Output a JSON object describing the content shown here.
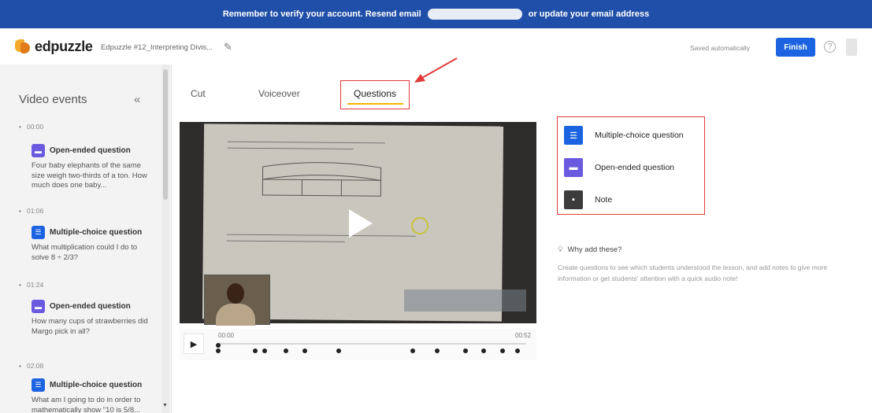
{
  "banner": {
    "text_before": "Remember to verify your account. Resend email",
    "text_after": "or update your email address"
  },
  "header": {
    "logo": "edpuzzle",
    "doc_title": "Edpuzzle #12_Interpreting Divis...",
    "saved": "Saved automatically",
    "finish": "Finish",
    "help": "?"
  },
  "sidebar": {
    "title": "Video events",
    "collapse": "«",
    "events": [
      {
        "time": "00:00",
        "type": "Open-ended question",
        "text": "Four baby elephants of the same size weigh two-thirds of a ton. How much does one baby..."
      },
      {
        "time": "01:06",
        "type": "Multiple-choice question",
        "text": "What multiplication could I do to solve 8 ÷ 2/3?"
      },
      {
        "time": "01:24",
        "type": "Open-ended question",
        "text": "How many cups of strawberries did Margo pick in all?"
      },
      {
        "time": "02:08",
        "type": "Multiple-choice question",
        "text": "What am I going to do in order to mathematically show \"10 is 5/8..."
      }
    ]
  },
  "tabs": [
    {
      "label": "Cut"
    },
    {
      "label": "Voiceover"
    },
    {
      "label": "Questions"
    }
  ],
  "timeline": {
    "start": "00:00",
    "end": "00:52",
    "dot_fractions": [
      0.0,
      0.0,
      0.12,
      0.15,
      0.22,
      0.28,
      0.39,
      0.63,
      0.71,
      0.8,
      0.86,
      0.92,
      0.97
    ]
  },
  "question_types": [
    {
      "label": "Multiple-choice question",
      "icon": "list-icon",
      "color": "#1b63e0"
    },
    {
      "label": "Open-ended question",
      "icon": "chat-icon",
      "color": "#6a5ae0"
    },
    {
      "label": "Note",
      "icon": "note-icon",
      "color": "#3b3b3b"
    }
  ],
  "why": {
    "title": "Why add these?",
    "desc": "Create questions to see which students understood the lesson, and add notes to give more information or get students' attention with a quick audio note!"
  },
  "colors": {
    "banner": "#1f4fa8",
    "accent": "#1b63e0",
    "open_ended": "#6a5ae0",
    "tab_underline": "#f5b400",
    "annotation": "#e23a3a"
  }
}
